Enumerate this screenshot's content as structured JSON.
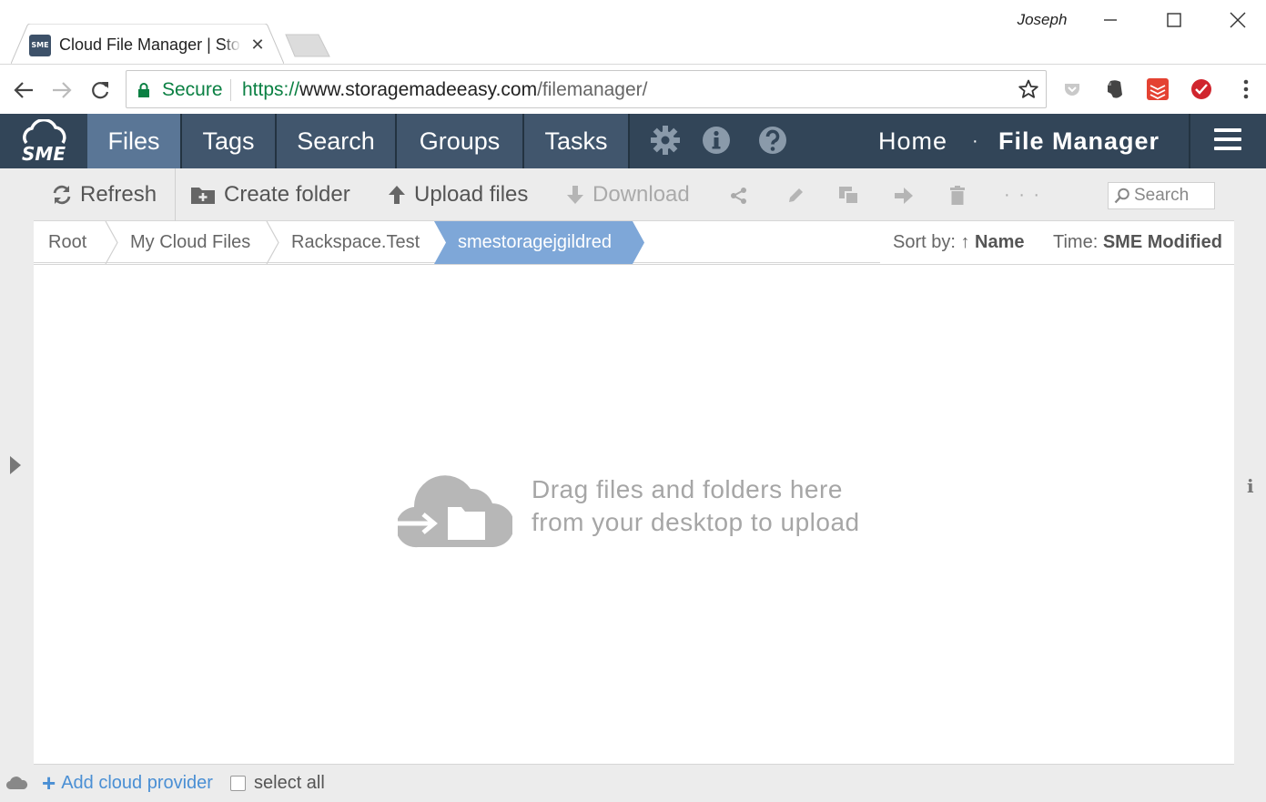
{
  "browser": {
    "tab_title": "Cloud File Manager | Storage Made Easy",
    "favicon_text": "SME",
    "profile_name": "Joseph",
    "security_label": "Secure",
    "url_scheme": "https://",
    "url_host": "www.storagemadeeasy.com",
    "url_path": "/filemanager/"
  },
  "nav": {
    "logo_text": "SME",
    "tabs": [
      "Files",
      "Tags",
      "Search",
      "Groups",
      "Tasks"
    ],
    "active_tab": "Files",
    "home_label": "Home",
    "separator": "·",
    "current_page": "File Manager"
  },
  "actions": {
    "refresh": "Refresh",
    "create_folder": "Create folder",
    "upload_files": "Upload files",
    "download": "Download",
    "more": "· · ·",
    "search_placeholder": "Search"
  },
  "breadcrumb": {
    "items": [
      "Root",
      "My Cloud Files",
      "Rackspace.Test"
    ],
    "current": "smestoragejgildred"
  },
  "sort": {
    "sort_label": "Sort by: ↑",
    "sort_value": "Name",
    "time_label": "Time:",
    "time_value": "SME Modified"
  },
  "dropzone": {
    "line1": "Drag files and folders here",
    "line2": "from your desktop to upload"
  },
  "footer": {
    "add_provider": "Add cloud provider",
    "plus": "+",
    "select_all": "select all"
  },
  "colors": {
    "nav_bg": "#324558",
    "nav_active": "#5a7696",
    "crumb_active": "#7ea7d8",
    "secure_green": "#0b8043",
    "link_blue": "#4a8fd4"
  }
}
